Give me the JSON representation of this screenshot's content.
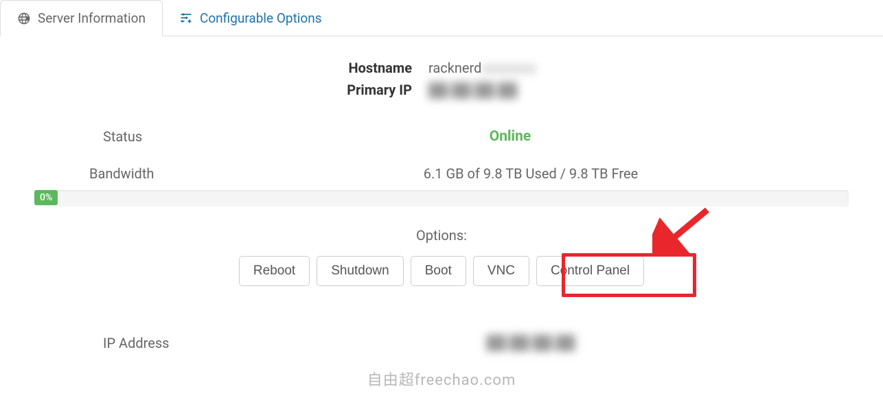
{
  "tabs": {
    "server_info": "Server Information",
    "configurable_options": "Configurable Options"
  },
  "info": {
    "hostname_label": "Hostname",
    "hostname_value": "racknerd",
    "primary_ip_label": "Primary IP",
    "primary_ip_value": "██.██.██.██"
  },
  "status": {
    "label": "Status",
    "value": "Online"
  },
  "bandwidth": {
    "label": "Bandwidth",
    "value": "6.1 GB of 9.8 TB Used / 9.8 TB Free",
    "percent": "0%"
  },
  "options": {
    "title": "Options:",
    "reboot": "Reboot",
    "shutdown": "Shutdown",
    "boot": "Boot",
    "vnc": "VNC",
    "control_panel": "Control Panel"
  },
  "ip": {
    "label": "IP Address",
    "value": "██.██.██.██"
  },
  "watermark": "自由超freechao.com"
}
